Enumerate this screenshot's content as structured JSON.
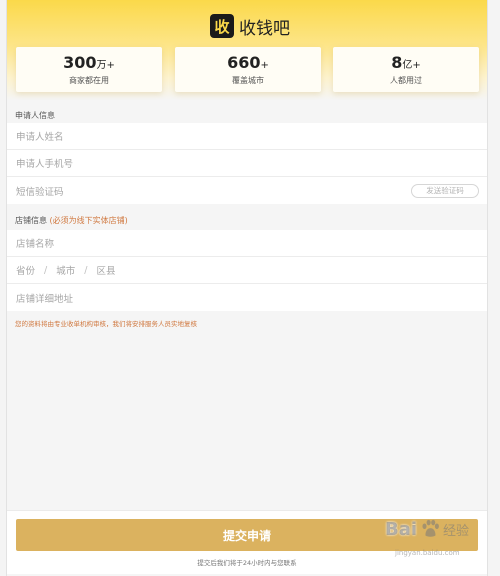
{
  "brand": {
    "logo_char": "收",
    "name": "收钱吧"
  },
  "stats": [
    {
      "number": "300",
      "unit": "万+",
      "label": "商家都在用"
    },
    {
      "number": "660",
      "unit": "+",
      "label": "覆盖城市"
    },
    {
      "number": "8",
      "unit": "亿+",
      "label": "人都用过"
    }
  ],
  "applicant": {
    "title": "申请人信息",
    "name_placeholder": "申请人姓名",
    "phone_placeholder": "申请人手机号",
    "sms_placeholder": "短信验证码",
    "sms_button": "发送验证码"
  },
  "store": {
    "title": "店铺信息",
    "title_note": "(必须为线下实体店铺)",
    "name_placeholder": "店铺名称",
    "province": "省份",
    "city": "城市",
    "district": "区县",
    "separator": "/",
    "address_placeholder": "店铺详细地址"
  },
  "notice": "您的资料将由专业收单机构审核，我们将安排服务人员实地复核",
  "submit": {
    "label": "提交申请",
    "hint": "提交后我们将于24小时内与您联系"
  },
  "watermark": {
    "left": "Bai",
    "right": "经验",
    "url": "jingyan.baidu.com"
  },
  "colors": {
    "brand_yellow": "#fbd94a",
    "submit_gold": "#dbb25f",
    "notice_orange": "#d0783f"
  }
}
